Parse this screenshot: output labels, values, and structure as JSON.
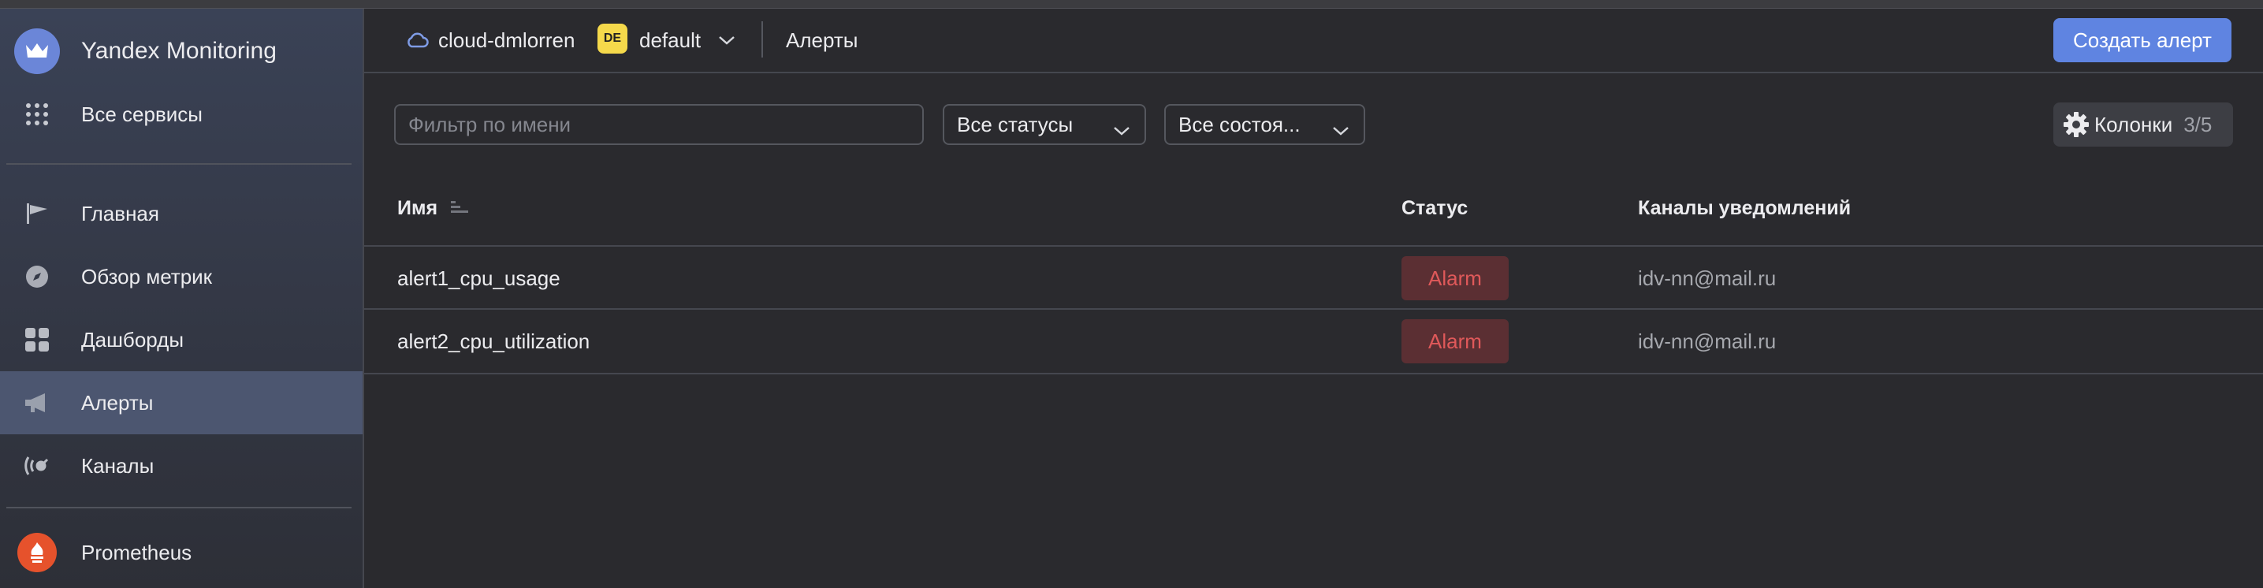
{
  "sidebar": {
    "brand": {
      "label": "Yandex Monitoring",
      "icon": "crown-icon"
    },
    "all_services": {
      "label": "Все сервисы",
      "icon": "grid-dots-icon"
    },
    "items": [
      {
        "label": "Главная",
        "icon": "flag-icon"
      },
      {
        "label": "Обзор метрик",
        "icon": "compass-icon"
      },
      {
        "label": "Дашборды",
        "icon": "dashboard-icon"
      },
      {
        "label": "Алерты",
        "icon": "megaphone-icon",
        "active": true
      },
      {
        "label": "Каналы",
        "icon": "channels-icon"
      }
    ],
    "prometheus": {
      "label": "Prometheus",
      "icon": "prometheus-icon"
    }
  },
  "header": {
    "cloud_icon": "cloud-icon",
    "cloud_name": "cloud-dmlorren",
    "folder_badge": "DE",
    "folder_name": "default",
    "page_title": "Алерты",
    "create_button": "Создать алерт"
  },
  "filters": {
    "name_placeholder": "Фильтр по имени",
    "status_select": "Все статусы",
    "state_select": "Все состоя...",
    "columns_button": "Колонки",
    "columns_count": "3/5"
  },
  "table": {
    "columns": [
      "Имя",
      "Статус",
      "Каналы уведомлений"
    ],
    "rows": [
      {
        "name": "alert1_cpu_usage",
        "status": "Alarm",
        "channel": "idv-nn@mail.ru"
      },
      {
        "name": "alert2_cpu_utilization",
        "status": "Alarm",
        "channel": "idv-nn@mail.ru"
      }
    ]
  },
  "colors": {
    "accent": "#5f84e1",
    "alarm_text": "#e0595a",
    "alarm_bg": "#5b2f33",
    "badge": "#f5d94b",
    "background": "#2a2a2e"
  }
}
